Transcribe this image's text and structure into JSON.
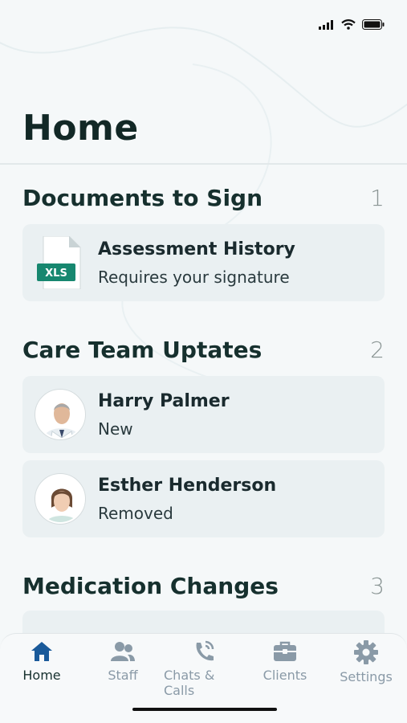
{
  "page": {
    "title": "Home"
  },
  "sections": [
    {
      "title": "Documents to Sign",
      "count": "1",
      "items": [
        {
          "title": "Assessment History",
          "subtitle": "Requires your signature",
          "file_type": "XLS",
          "icon": "xls-file-icon"
        }
      ]
    },
    {
      "title": "Care Team Uptates",
      "count": "2",
      "items": [
        {
          "title": "Harry Palmer",
          "subtitle": "New",
          "icon": "avatar-photo"
        },
        {
          "title": "Esther Henderson",
          "subtitle": "Removed",
          "icon": "avatar-photo"
        }
      ]
    },
    {
      "title": "Medication Changes",
      "count": "3",
      "items": []
    }
  ],
  "nav": {
    "items": [
      {
        "label": "Home",
        "icon": "home-icon",
        "active": true
      },
      {
        "label": "Staff",
        "icon": "people-icon",
        "active": false
      },
      {
        "label": "Chats & Calls",
        "icon": "phone-chat-icon",
        "active": false
      },
      {
        "label": "Clients",
        "icon": "briefcase-icon",
        "active": false
      },
      {
        "label": "Settings",
        "icon": "gear-icon",
        "active": false
      }
    ]
  },
  "colors": {
    "accent": "#1a5a9a",
    "file_badge": "#17876f",
    "nav_inactive": "#8a9aa7",
    "card_bg": "#eaf0f2"
  }
}
